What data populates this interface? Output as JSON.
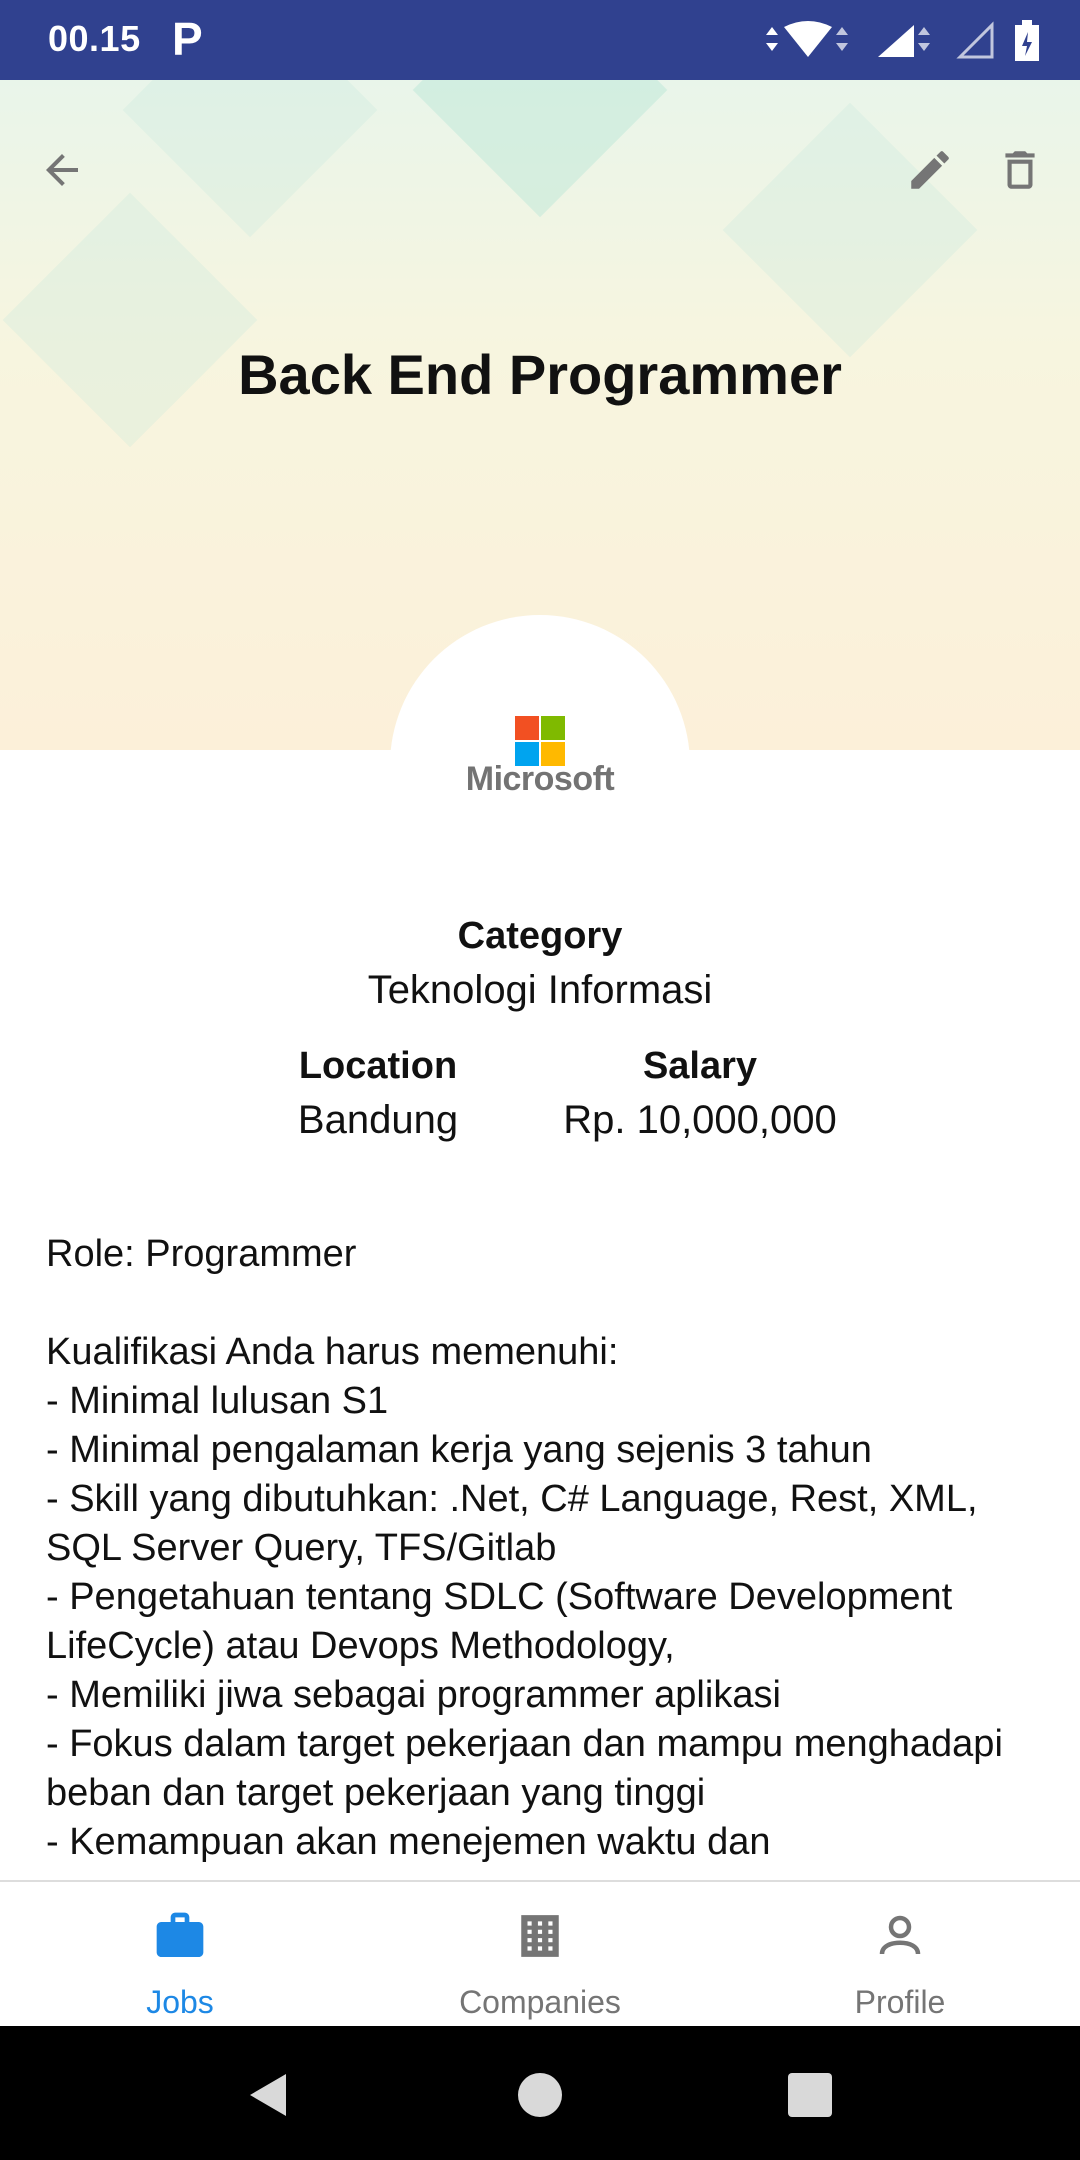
{
  "status_bar": {
    "time": "00.15",
    "notification_letter": "P",
    "colors": {
      "background": "#30418f"
    }
  },
  "header": {
    "back_icon": "arrow-back-icon",
    "edit_icon": "pencil-icon",
    "delete_icon": "trash-icon",
    "title": "Back End Programmer"
  },
  "company": {
    "logo_text": "Microsoft"
  },
  "info": {
    "category_label": "Category",
    "category_value": "Teknologi Informasi",
    "location_label": "Location",
    "location_value": "Bandung",
    "salary_label": "Salary",
    "salary_value": "Rp. 10,000,000"
  },
  "description": "Role: Programmer\n\nKualifikasi Anda harus memenuhi:\n- Minimal lulusan S1\n- Minimal pengalaman kerja yang sejenis 3 tahun\n- Skill yang dibutuhkan: .Net, C# Language, Rest, XML, SQL Server Query, TFS/Gitlab\n- Pengetahuan tentang SDLC (Software Development LifeCycle) atau Devops Methodology,\n- Memiliki jiwa sebagai programmer aplikasi\n- Fokus dalam target pekerjaan dan mampu menghadapi beban dan target pekerjaan yang tinggi\n- Kemampuan akan menejemen waktu dan",
  "bottom_nav": {
    "items": [
      {
        "label": "Jobs",
        "icon": "briefcase-icon",
        "active": true
      },
      {
        "label": "Companies",
        "icon": "building-icon",
        "active": false
      },
      {
        "label": "Profile",
        "icon": "person-icon",
        "active": false
      }
    ],
    "colors": {
      "active": "#1d88e5",
      "inactive": "#757575"
    }
  }
}
